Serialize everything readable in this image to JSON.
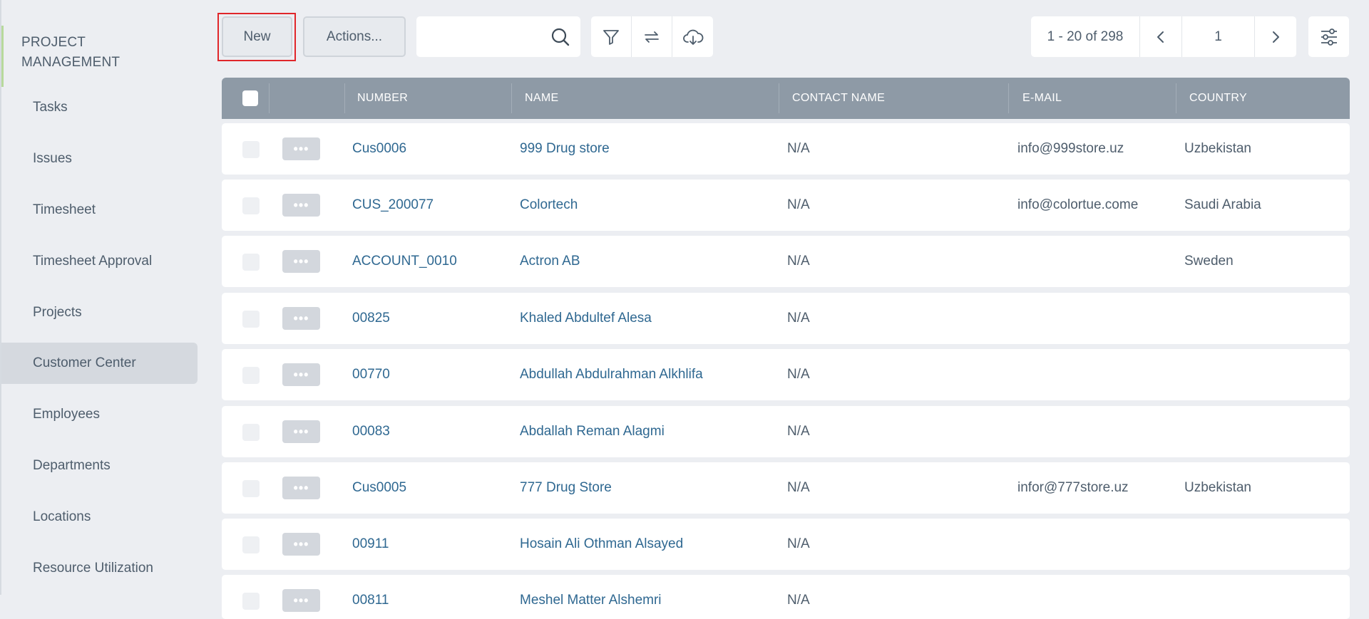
{
  "sidebar": {
    "title": "PROJECT MANAGEMENT",
    "items": [
      {
        "label": "Tasks"
      },
      {
        "label": "Issues"
      },
      {
        "label": "Timesheet"
      },
      {
        "label": "Timesheet Approval"
      },
      {
        "label": "Projects"
      },
      {
        "label": "Customer Center"
      },
      {
        "label": "Employees"
      },
      {
        "label": "Departments"
      },
      {
        "label": "Locations"
      },
      {
        "label": "Resource Utilization"
      }
    ],
    "active_item": "Customer Center"
  },
  "toolbar": {
    "new_label": "New",
    "actions_label": "Actions...",
    "search_placeholder": "",
    "icons": [
      "search-icon",
      "filter-icon",
      "refresh-icon",
      "download-icon",
      "settings-sliders-icon"
    ]
  },
  "pager": {
    "range": "1 - 20 of 298",
    "page": "1"
  },
  "table": {
    "columns": [
      "NUMBER",
      "NAME",
      "CONTACT NAME",
      "E-MAIL",
      "COUNTRY"
    ],
    "rows": [
      {
        "number": "Cus0006",
        "name": "999 Drug store",
        "contact": "N/A",
        "email": "info@999store.uz",
        "country": "Uzbekistan"
      },
      {
        "number": "CUS_200077",
        "name": "Colortech",
        "contact": "N/A",
        "email": "info@colortue.come",
        "country": "Saudi Arabia"
      },
      {
        "number": "ACCOUNT_0010",
        "name": "Actron AB",
        "contact": "N/A",
        "email": "",
        "country": "Sweden"
      },
      {
        "number": "00825",
        "name": "Khaled Abdultef Alesa",
        "contact": "N/A",
        "email": "",
        "country": ""
      },
      {
        "number": "00770",
        "name": "Abdullah Abdulrahman Alkhlifa",
        "contact": "N/A",
        "email": "",
        "country": ""
      },
      {
        "number": "00083",
        "name": "Abdallah Reman Alagmi",
        "contact": "N/A",
        "email": "",
        "country": ""
      },
      {
        "number": "Cus0005",
        "name": "777 Drug Store",
        "contact": "N/A",
        "email": "infor@777store.uz",
        "country": "Uzbekistan"
      },
      {
        "number": "00911",
        "name": "Hosain Ali Othman Alsayed",
        "contact": "N/A",
        "email": "",
        "country": ""
      },
      {
        "number": "00811",
        "name": "Meshel Matter Alshemri",
        "contact": "N/A",
        "email": "",
        "country": ""
      }
    ],
    "more_glyph": "•••"
  },
  "colors": {
    "background": "#eceef2",
    "header": "#8e9aa6",
    "link": "#2f6891",
    "highlight": "#e0262a",
    "active_sidebar": "#d5d9df"
  }
}
